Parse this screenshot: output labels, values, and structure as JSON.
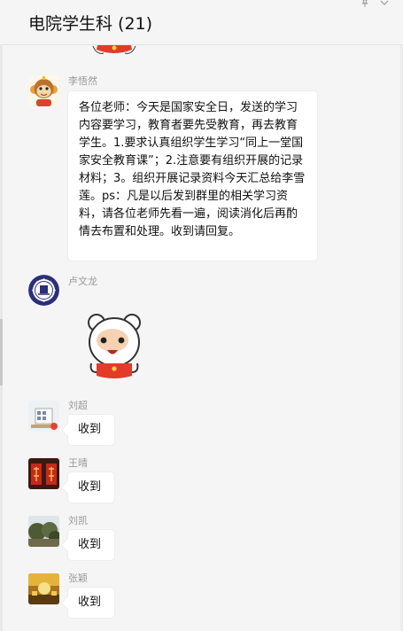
{
  "header": {
    "title": "电院学生科 (21)",
    "icons": [
      "pin-icon",
      "chevron-down-icon"
    ]
  },
  "messages": [
    {
      "sender": "李悟然",
      "avatar": "monkey-avatar",
      "type": "text",
      "text": "各位老师：今天是国家安全日，发送的学习内容要学习，教育者要先受教育，再去教育学生。1.要求认真组织学生学习“同上一堂国家安全教育课”；2.注意要有组织开展的记录材料；3。组织开展记录资料今天汇总给李雪莲。ps：凡是以后发到群里的相关学习资料，请各位老师先看一遍，阅读消化后再酌情去布置和处理。收到请回复。"
    },
    {
      "sender": "卢文龙",
      "avatar": "school-emblem-avatar",
      "type": "sticker",
      "sticker": "bear-sticker"
    },
    {
      "sender": "刘超",
      "avatar": "building-avatar",
      "type": "text",
      "text": "收到"
    },
    {
      "sender": "王晴",
      "avatar": "red-fu-avatar",
      "type": "text",
      "text": "收到"
    },
    {
      "sender": "刘凯",
      "avatar": "landscape-avatar",
      "type": "text",
      "text": "收到"
    },
    {
      "sender": "张颖",
      "avatar": "golden-avatar",
      "type": "text",
      "text": "收到"
    }
  ]
}
